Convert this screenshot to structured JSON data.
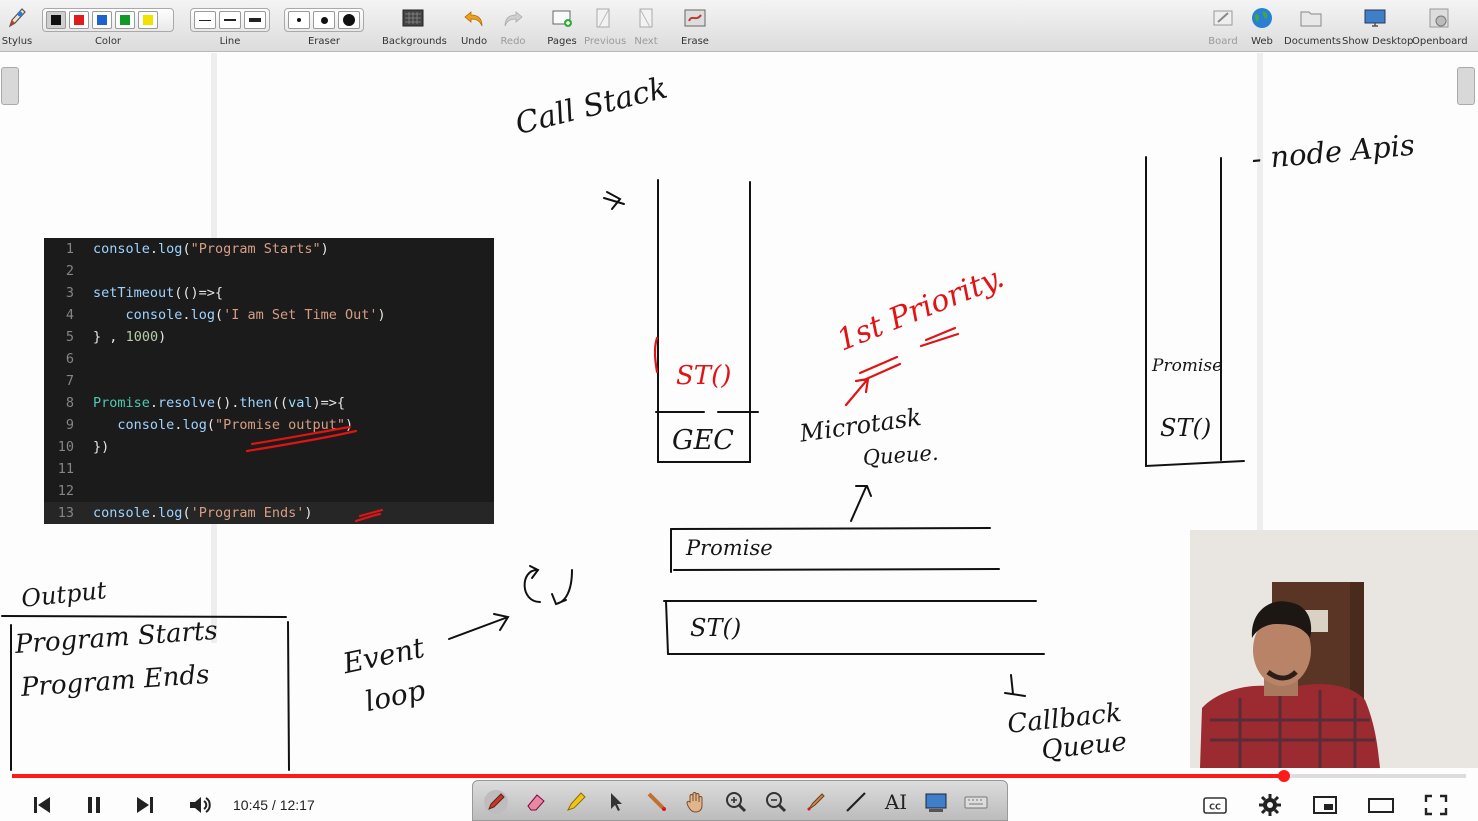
{
  "toolbar": {
    "stylus": {
      "label": "Stylus",
      "icon": "stylus-icon"
    },
    "color": {
      "label": "Color",
      "swatches": [
        "#111111",
        "#e11b1b",
        "#1e62d0",
        "#129a26",
        "#f2e200"
      ],
      "selected_index": 0
    },
    "line": {
      "label": "Line",
      "options": [
        "thin",
        "medium",
        "thick"
      ]
    },
    "eraser": {
      "label": "Eraser",
      "options": [
        "small",
        "medium",
        "large"
      ]
    },
    "backgrounds": {
      "label": "Backgrounds",
      "icon": "backgrounds-icon"
    },
    "undo": {
      "label": "Undo",
      "icon": "undo-icon"
    },
    "redo": {
      "label": "Redo",
      "icon": "redo-icon"
    },
    "pages": {
      "label": "Pages",
      "icon": "pages-icon"
    },
    "previous": {
      "label": "Previous",
      "icon": "previous-page-icon"
    },
    "next": {
      "label": "Next",
      "icon": "next-page-icon"
    },
    "erase": {
      "label": "Erase",
      "icon": "erase-board-icon"
    },
    "board": {
      "label": "Board",
      "icon": "board-icon"
    },
    "web": {
      "label": "Web",
      "icon": "globe-icon"
    },
    "documents": {
      "label": "Documents",
      "icon": "folder-icon"
    },
    "show_desktop": {
      "label": "Show Desktop",
      "icon": "desktop-icon"
    },
    "openboard": {
      "label": "Openboard",
      "icon": "openboard-icon"
    }
  },
  "code": {
    "lines": [
      {
        "n": "1",
        "text": "console.log(\"Program Starts\")"
      },
      {
        "n": "2",
        "text": ""
      },
      {
        "n": "3",
        "text": "setTimeout(()=>{"
      },
      {
        "n": "4",
        "text": "    console.log('I am Set Time Out')"
      },
      {
        "n": "5",
        "text": "} , 1000)"
      },
      {
        "n": "6",
        "text": ""
      },
      {
        "n": "7",
        "text": ""
      },
      {
        "n": "8",
        "text": "Promise.resolve().then((val)=>{"
      },
      {
        "n": "9",
        "text": "   console.log(\"Promise output\")"
      },
      {
        "n": "10",
        "text": "})"
      },
      {
        "n": "11",
        "text": ""
      },
      {
        "n": "12",
        "text": ""
      },
      {
        "n": "13",
        "text": "console.log('Program Ends')"
      }
    ]
  },
  "handwriting": {
    "call_stack_title": "Call Stack",
    "arrow_mark": "->",
    "stack_top": "ST()",
    "stack_bottom": "GEC",
    "priority": "1st Priority.",
    "microtask": "Microtask",
    "microtask_queue": "Queue.",
    "node_apis": "- node Apis",
    "api_promise": "Promise",
    "api_st": "ST()",
    "queue_promise": "Promise",
    "queue_st": "ST()",
    "callback": "Callback",
    "callback_queue": "Queue",
    "output_title": "Output",
    "output_line1": "Program Starts",
    "output_line2": "Program Ends",
    "event_loop_1": "Event",
    "event_loop_2": "loop"
  },
  "player": {
    "current_time": "10:45",
    "duration": "12:17",
    "time_separator": " / ",
    "progress": 0.875,
    "accent": "#ff1a1a"
  },
  "palette": {
    "tools": [
      "pen-icon",
      "eraser-tool-icon",
      "highlighter-icon",
      "pointer-icon",
      "laser-pointer-icon",
      "hand-icon",
      "zoom-in-icon",
      "zoom-out-icon",
      "marker-icon",
      "line-tool-icon",
      "text-tool-icon",
      "capture-icon",
      "keyboard-icon"
    ],
    "text_tool_label": "AI"
  }
}
